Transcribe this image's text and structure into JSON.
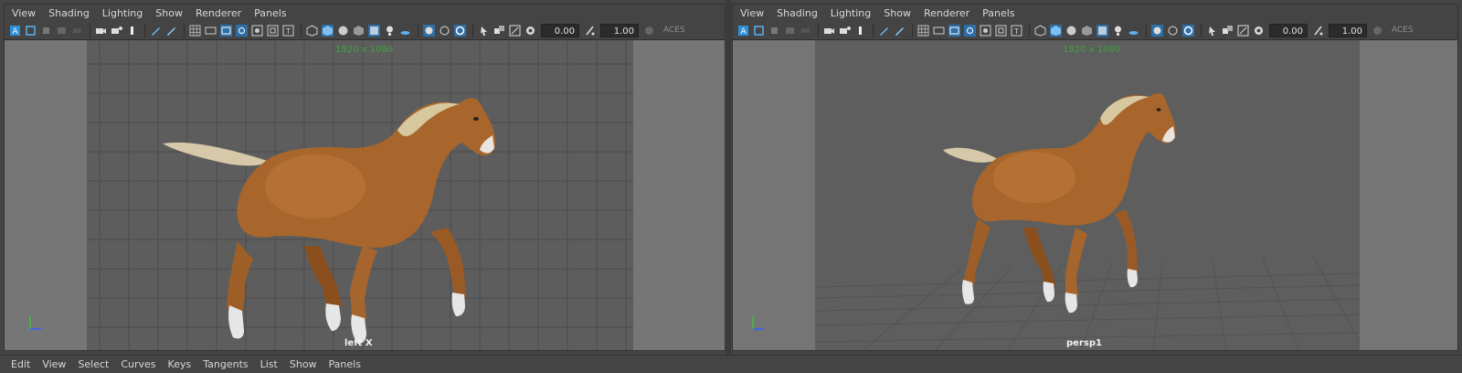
{
  "panels": {
    "left": {
      "menu": [
        "View",
        "Shading",
        "Lighting",
        "Show",
        "Renderer",
        "Panels"
      ],
      "field_a": "0.00",
      "field_b": "1.00",
      "colorspace": "ACES",
      "resolution": "1920 x 1080",
      "camera": "left X"
    },
    "right": {
      "menu": [
        "View",
        "Shading",
        "Lighting",
        "Show",
        "Renderer",
        "Panels"
      ],
      "field_a": "0.00",
      "field_b": "1.00",
      "colorspace": "ACES",
      "resolution": "1920 x 1080",
      "camera": "persp1"
    }
  },
  "graph_editor_menu": [
    "Edit",
    "View",
    "Select",
    "Curves",
    "Keys",
    "Tangents",
    "List",
    "Show",
    "Panels"
  ],
  "colors": {
    "accent": "#2f8fd8",
    "horse_body": "#a8662c",
    "mane": "#d8c8a0",
    "resolution_text": "#3fa33f"
  },
  "icons": [
    "camera-select-icon",
    "camera-attributes-icon",
    "bookmark-icon",
    "image-plane-icon",
    "grid-icon",
    "film-gate-icon",
    "resolution-gate-icon",
    "gate-mask-icon",
    "safe-action-icon",
    "wireframe-icon",
    "smooth-shade-icon",
    "textured-icon",
    "lights-icon",
    "shadows-icon",
    "ambient-occlusion-icon",
    "isolate-select-icon",
    "xray-icon",
    "exposure-icon",
    "gamma-icon",
    "colorspace-icon"
  ]
}
